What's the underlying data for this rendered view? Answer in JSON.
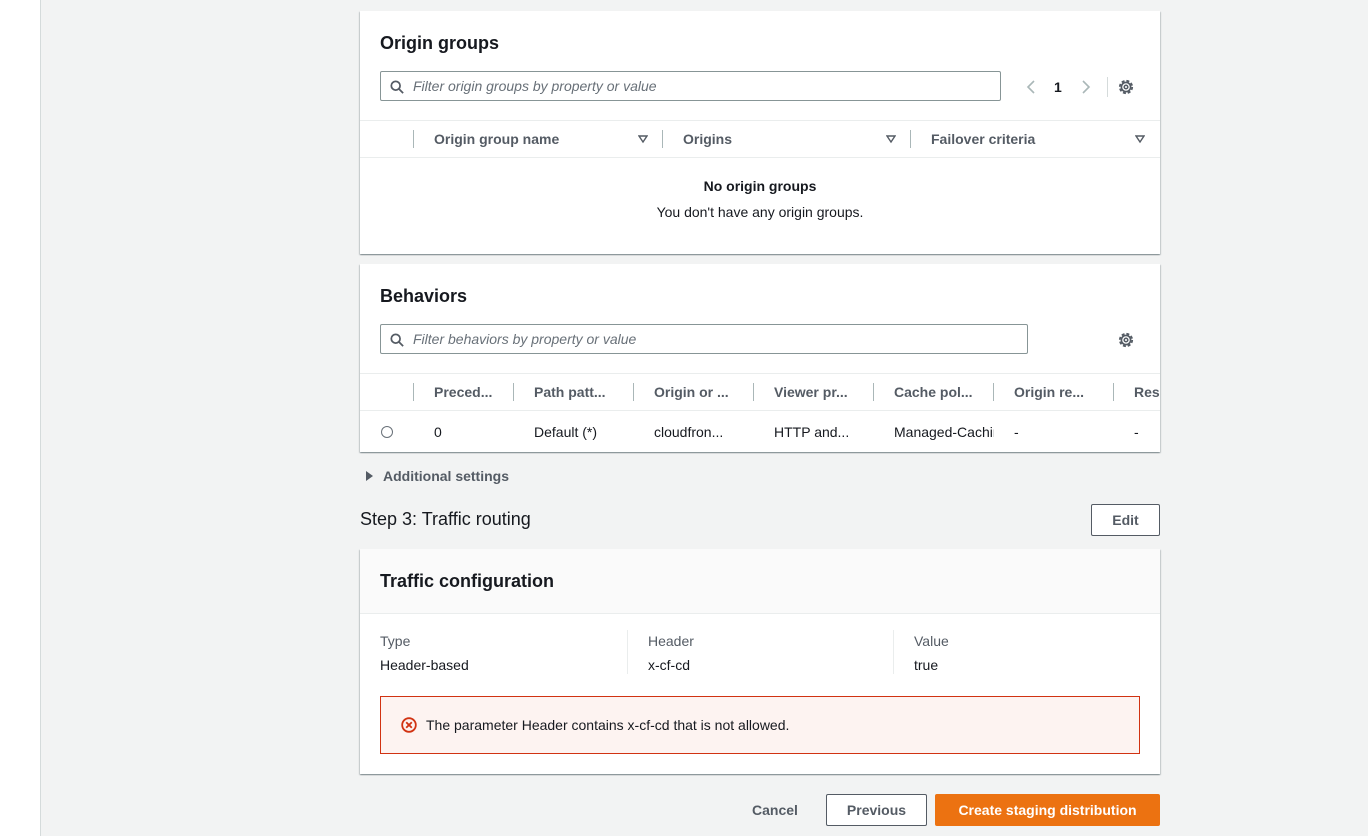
{
  "origin_groups": {
    "title": "Origin groups",
    "filter_placeholder": "Filter origin groups by property or value",
    "page_number": "1",
    "columns": [
      "Origin group name",
      "Origins",
      "Failover criteria"
    ],
    "empty_title": "No origin groups",
    "empty_text": "You don't have any origin groups."
  },
  "behaviors": {
    "title": "Behaviors",
    "filter_placeholder": "Filter behaviors by property or value",
    "columns": [
      "Preced...",
      "Path patt...",
      "Origin or ...",
      "Viewer pr...",
      "Cache pol...",
      "Origin re...",
      "Respo"
    ],
    "rows": [
      [
        "0",
        "Default (*)",
        "cloudfron...",
        "HTTP and...",
        "Managed-Caching",
        "-",
        "-"
      ]
    ]
  },
  "additional_settings_label": "Additional settings",
  "step3": {
    "title": "Step 3: Traffic routing",
    "edit_label": "Edit"
  },
  "traffic_config": {
    "title": "Traffic configuration",
    "fields": [
      {
        "label": "Type",
        "value": "Header-based"
      },
      {
        "label": "Header",
        "value": "x-cf-cd"
      },
      {
        "label": "Value",
        "value": "true"
      }
    ],
    "error_message": "The parameter Header contains x-cf-cd that is not allowed."
  },
  "footer": {
    "cancel_label": "Cancel",
    "previous_label": "Previous",
    "create_label": "Create staging distribution"
  },
  "colors": {
    "primary": "#ec7211",
    "error": "#d13212",
    "error_bg": "#fdf3f1"
  },
  "icons": [
    "search-icon",
    "chevron-left-icon",
    "chevron-right-icon",
    "gear-icon",
    "sort-caret-icon",
    "expand-caret-icon",
    "error-icon"
  ]
}
